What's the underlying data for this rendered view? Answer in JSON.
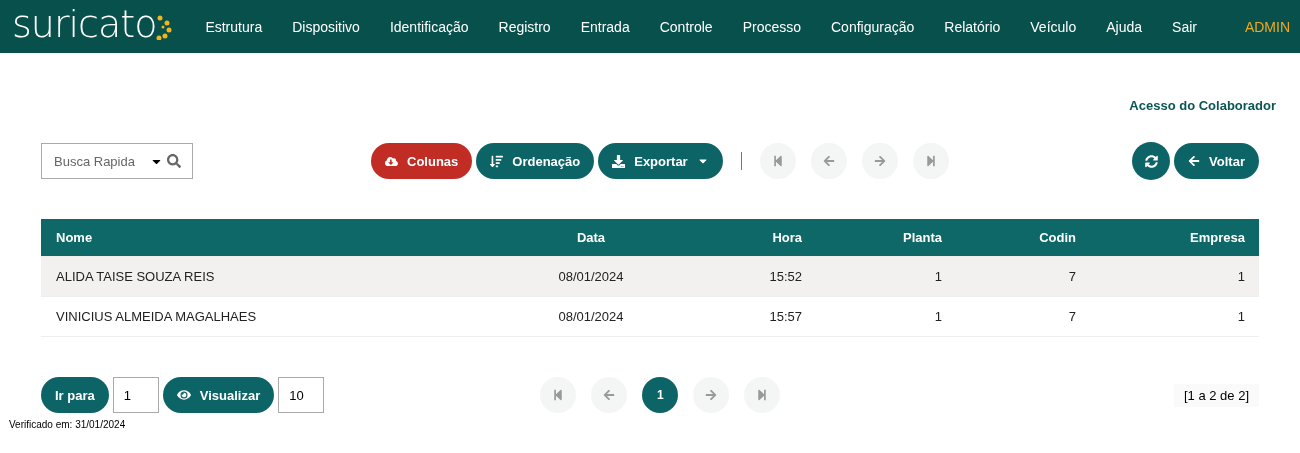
{
  "header": {
    "logo": "suricato",
    "menu": [
      {
        "label": "Estrutura"
      },
      {
        "label": "Dispositivo"
      },
      {
        "label": "Identificação"
      },
      {
        "label": "Registro"
      },
      {
        "label": "Entrada"
      },
      {
        "label": "Controle"
      },
      {
        "label": "Processo"
      },
      {
        "label": "Configuração"
      },
      {
        "label": "Relatório"
      },
      {
        "label": "Veículo"
      },
      {
        "label": "Ajuda"
      },
      {
        "label": "Sair"
      }
    ],
    "user": "ADMIN"
  },
  "page_title": "Acesso do Colaborador",
  "search": {
    "placeholder": "Busca Rapida"
  },
  "toolbar": [
    {
      "label": "Colunas",
      "kind": "danger"
    },
    {
      "label": "Ordenação",
      "kind": "primary"
    },
    {
      "label": "Exportar",
      "kind": "primary",
      "dropdown": true
    }
  ],
  "top_pager": [
    {
      "disabled": true
    },
    {
      "disabled": true
    },
    {
      "disabled": true
    },
    {
      "disabled": true
    }
  ],
  "back_button": "Voltar",
  "table": {
    "columns": [
      "Nome",
      "Data",
      "Hora",
      "Planta",
      "Codin",
      "Empresa"
    ],
    "rows": [
      [
        "ALIDA TAISE SOUZA REIS",
        "08/01/2024",
        "15:52",
        "1",
        "7",
        "1"
      ],
      [
        "VINICIUS ALMEIDA MAGALHAES",
        "08/01/2024",
        "15:57",
        "1",
        "7",
        "1"
      ]
    ]
  },
  "footer": {
    "goto_label": "Ir para",
    "goto_value": "1",
    "view_label": "Visualizar",
    "view_value": "10",
    "pager": [
      {
        "disabled": true
      },
      {
        "disabled": true
      },
      {
        "label": "1",
        "selected": true
      },
      {
        "disabled": true
      },
      {
        "disabled": true
      }
    ],
    "range": "[1 a 2 de 2]"
  },
  "verified": "Verificado em: 31/01/2024"
}
